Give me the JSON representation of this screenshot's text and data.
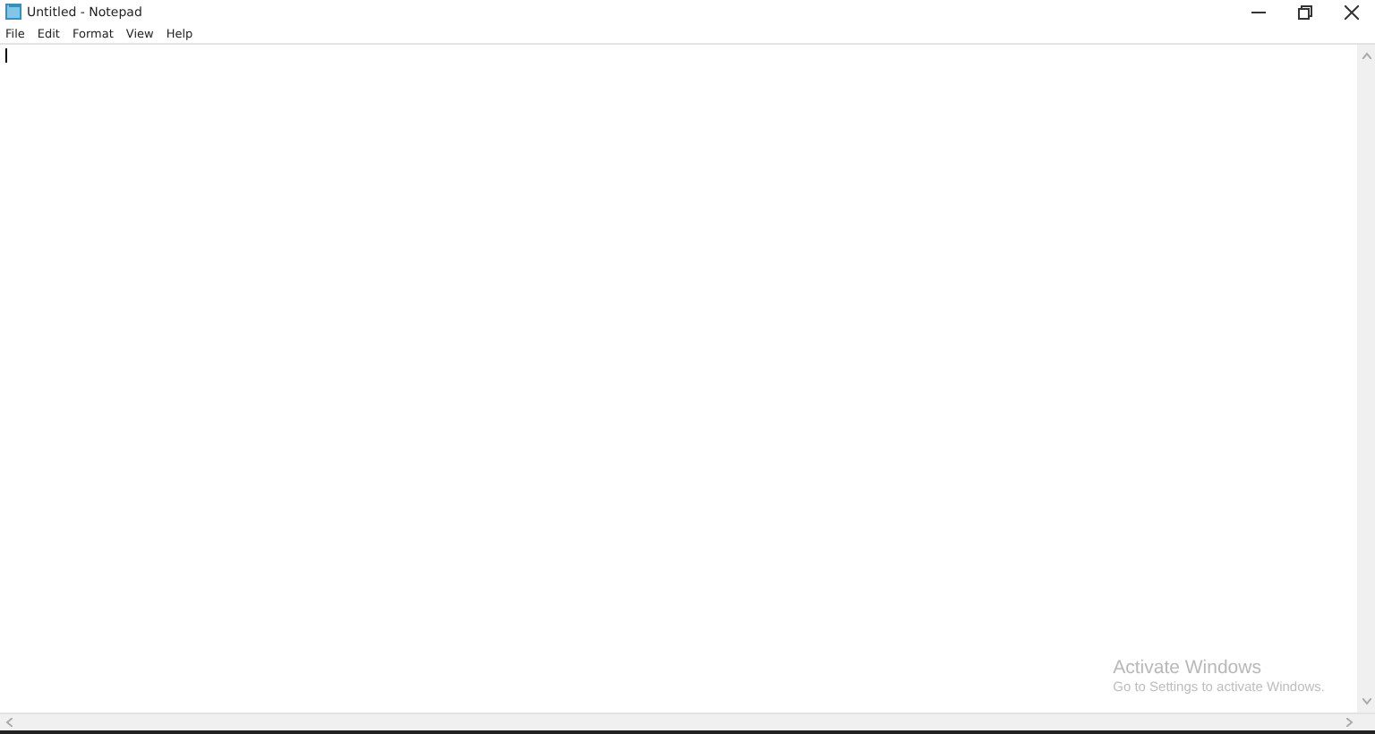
{
  "window": {
    "title": "Untitled - Notepad"
  },
  "menu": [
    "File",
    "Edit",
    "Format",
    "View",
    "Help"
  ],
  "overlay": {
    "heading": "Activate Windows",
    "subtext": "Go to Settings to activate Windows."
  }
}
